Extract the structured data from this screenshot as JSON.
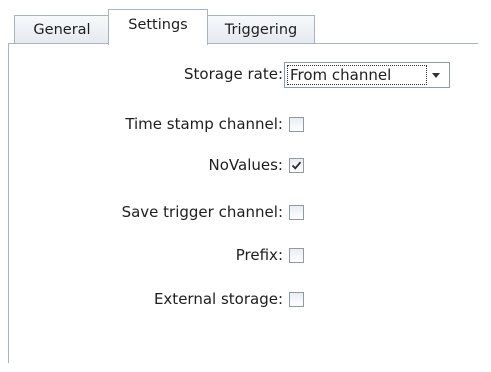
{
  "tabs": [
    {
      "label": "General",
      "selected": false
    },
    {
      "label": "Settings",
      "selected": true
    },
    {
      "label": "Triggering",
      "selected": false
    }
  ],
  "settings": {
    "storage_rate": {
      "label": "Storage rate:",
      "value": "From channel",
      "icon": "chevron-down-icon"
    },
    "time_stamp_channel": {
      "label": "Time stamp channel:",
      "checked": false
    },
    "no_values": {
      "label": "NoValues:",
      "checked": true
    },
    "save_trigger_channel": {
      "label": "Save trigger channel:",
      "checked": false
    },
    "prefix": {
      "label": "Prefix:",
      "checked": false
    },
    "external_storage": {
      "label": "External storage:",
      "checked": false
    }
  },
  "colors": {
    "border": "#a9b4c2",
    "checkbox_border": "#8e9aa8",
    "text": "#1e1e1e"
  }
}
